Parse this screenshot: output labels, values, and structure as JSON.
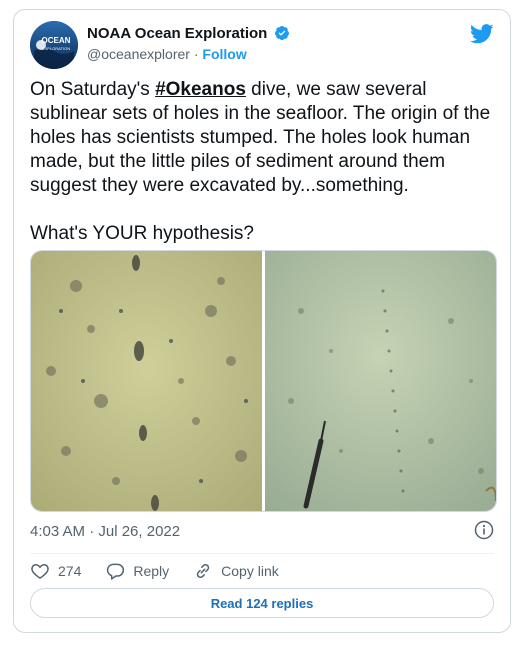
{
  "author": {
    "name": "NOAA Ocean Exploration",
    "handle": "@oceanexplorer",
    "separator": "·",
    "follow_label": "Follow",
    "avatar_text": "OCEAN",
    "avatar_subtext": "EXPLORATION"
  },
  "tweet": {
    "text_before": "On Saturday's ",
    "hashtag": "#Okeanos",
    "text_after": " dive, we saw several sublinear sets of holes in the seafloor. The origin of the holes has scientists stumped. The holes look human made, but the little piles of sediment around them suggest they were excavated by...something.\n\nWhat's YOUR hypothesis?",
    "timestamp": "4:03 AM · Jul 26, 2022"
  },
  "actions": {
    "likes_count": "274",
    "reply_label": "Reply",
    "copy_link_label": "Copy link",
    "read_replies_label": "Read 124 replies"
  },
  "colors": {
    "accent": "#1d9bf0",
    "muted": "#536471",
    "border": "#cfd9de"
  },
  "icons": [
    "verified-badge-icon",
    "twitter-bird-icon",
    "info-icon",
    "heart-icon",
    "reply-icon",
    "link-icon"
  ]
}
